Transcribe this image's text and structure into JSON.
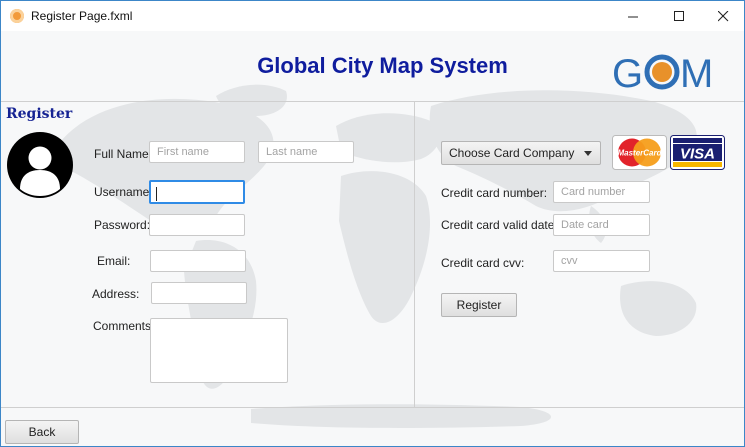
{
  "window": {
    "title": "Register Page.fxml",
    "minimize_icon": "minimize-icon",
    "maximize_icon": "maximize-icon",
    "close_icon": "close-icon"
  },
  "header": {
    "title": "Global City Map System",
    "logo_text": "GCM"
  },
  "register": {
    "section_title": "Register",
    "full_name_label": "Full Name:",
    "first_name_placeholder": "First name",
    "last_name_placeholder": "Last name",
    "username_label": "Username:",
    "username_value": "",
    "password_label": "Password:",
    "email_label": "Email:",
    "address_label": "Address:",
    "comments_label": "Comments:"
  },
  "payment": {
    "card_company_label": "Choose Card Company",
    "mastercard_text": "MasterCard",
    "visa_text": "VISA",
    "card_number_label": "Credit card number:",
    "card_number_placeholder": "Card number",
    "valid_date_label": "Credit card valid date:",
    "valid_date_placeholder": "Date card",
    "cvv_label": "Credit card cvv:",
    "cvv_placeholder": "cvv",
    "register_button": "Register"
  },
  "footer": {
    "back_button": "Back"
  },
  "colors": {
    "title_blue": "#0f1d9e",
    "focus_blue": "#2f8be6",
    "logo_blue": "#2f6fb5",
    "logo_orange": "#e8912a"
  }
}
